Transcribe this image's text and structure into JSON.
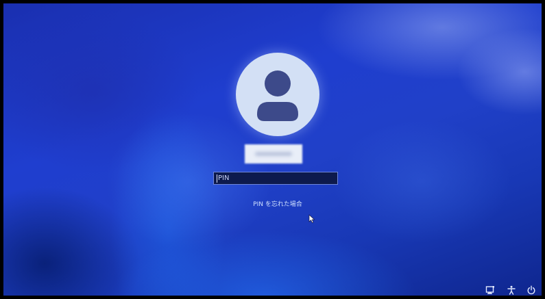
{
  "login": {
    "user_name": "",
    "pin_placeholder": "PIN",
    "pin_value": "",
    "forgot_pin_link": "PIN を忘れた場合"
  },
  "tray": {
    "icons": [
      "network-icon",
      "accessibility-icon",
      "power-icon"
    ]
  },
  "colors": {
    "background_blue": "#1f3ecf",
    "avatar_bg": "#d3e0f5",
    "avatar_figure": "#3d4a8a",
    "link_text": "#cfe0ff"
  }
}
